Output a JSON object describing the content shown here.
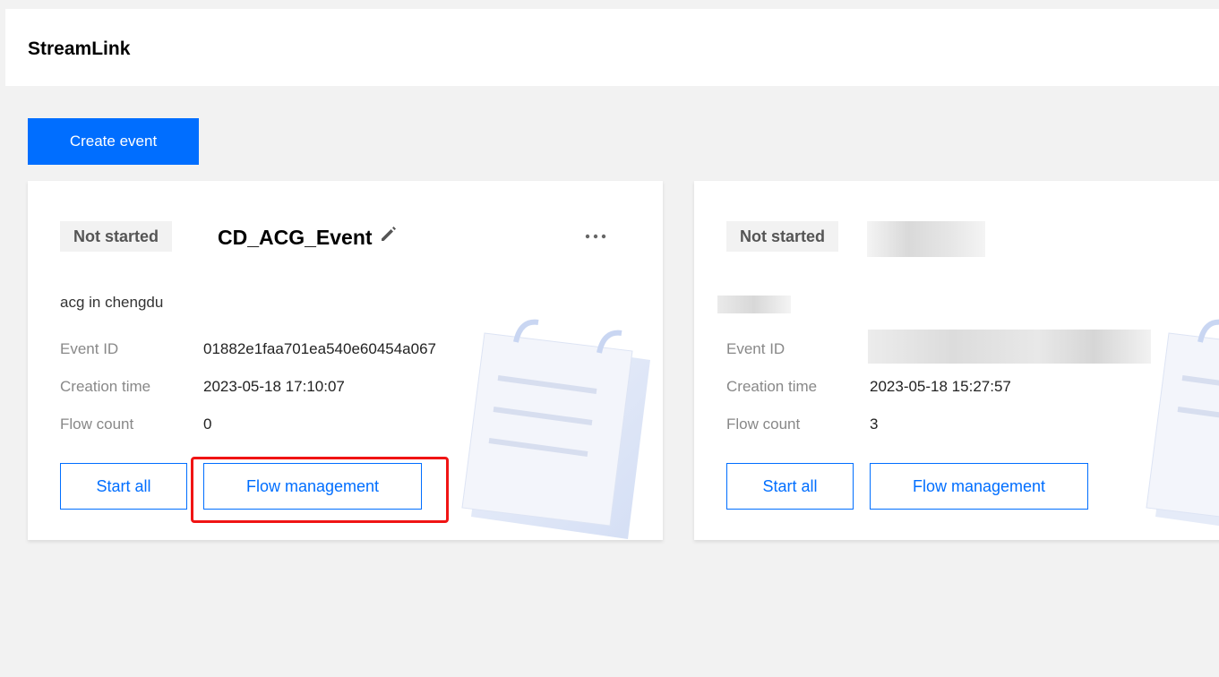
{
  "app": {
    "title": "StreamLink"
  },
  "toolbar": {
    "create_label": "Create event"
  },
  "cards": [
    {
      "status": "Not started",
      "title": "CD_ACG_Event",
      "description": "acg in chengdu",
      "fields": [
        {
          "label": "Event ID",
          "value": "01882e1faa701ea540e60454a067"
        },
        {
          "label": "Creation time",
          "value": "2023-05-18 17:10:07"
        },
        {
          "label": "Flow count",
          "value": "0"
        }
      ],
      "start_all_label": "Start all",
      "flow_management_label": "Flow management",
      "highlighted": "flow-management-button"
    },
    {
      "status": "Not started",
      "title": "",
      "description": "",
      "fields": [
        {
          "label": "Event ID",
          "value": ""
        },
        {
          "label": "Creation time",
          "value": "2023-05-18 15:27:57"
        },
        {
          "label": "Flow count",
          "value": "3"
        }
      ],
      "start_all_label": "Start all",
      "flow_management_label": "Flow management"
    }
  ],
  "icons": {
    "edit": "pencil-icon",
    "more": "ellipsis-icon",
    "illustration": "calendar-illustration"
  },
  "colors": {
    "primary": "#006eff",
    "highlight": "#f01414",
    "badge_bg": "#f2f2f2"
  }
}
